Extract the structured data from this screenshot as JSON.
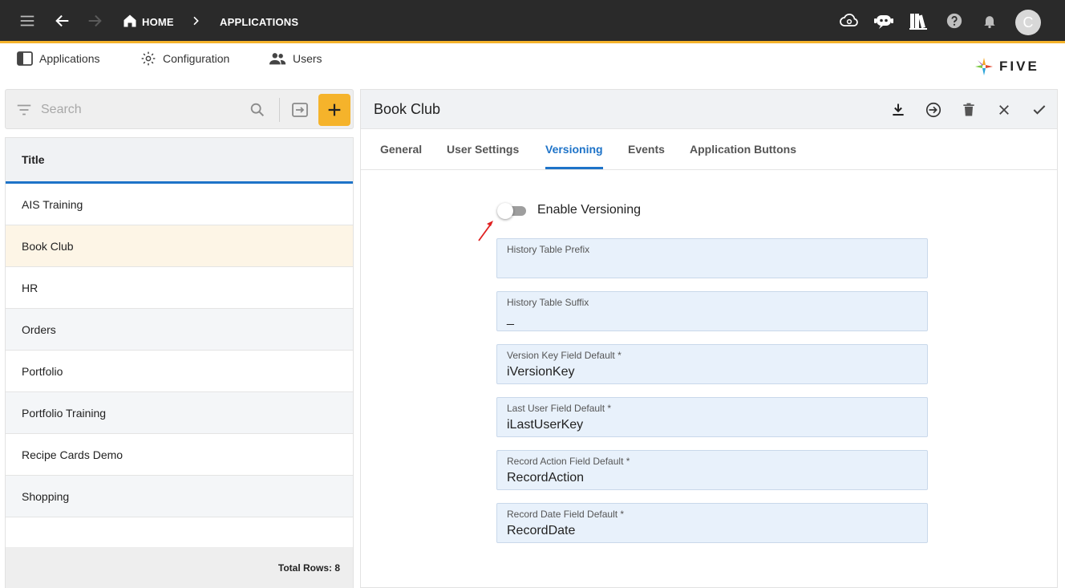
{
  "topbar": {
    "breadcrumb": [
      {
        "label": "HOME"
      },
      {
        "label": "APPLICATIONS"
      }
    ],
    "avatar_initial": "C"
  },
  "secnav": {
    "items": [
      {
        "label": "Applications",
        "icon": "applications-icon"
      },
      {
        "label": "Configuration",
        "icon": "configuration-icon"
      },
      {
        "label": "Users",
        "icon": "users-icon"
      }
    ],
    "logo_text": "FIVE"
  },
  "search": {
    "placeholder": "Search"
  },
  "list": {
    "header": "Title",
    "rows": [
      {
        "title": "AIS Training"
      },
      {
        "title": "Book Club"
      },
      {
        "title": "HR"
      },
      {
        "title": "Orders"
      },
      {
        "title": "Portfolio"
      },
      {
        "title": "Portfolio Training"
      },
      {
        "title": "Recipe Cards Demo"
      },
      {
        "title": "Shopping"
      }
    ],
    "selected_index": 1,
    "footer": "Total Rows: 8"
  },
  "detail": {
    "title": "Book Club",
    "tabs": [
      {
        "label": "General"
      },
      {
        "label": "User Settings"
      },
      {
        "label": "Versioning"
      },
      {
        "label": "Events"
      },
      {
        "label": "Application Buttons"
      }
    ],
    "active_tab": "Versioning",
    "toggle": {
      "label": "Enable Versioning",
      "checked": false
    },
    "fields": [
      {
        "label": "History Table Prefix",
        "value": ""
      },
      {
        "label": "History Table Suffix",
        "value": "_"
      },
      {
        "label": "Version Key Field Default *",
        "value": "iVersionKey"
      },
      {
        "label": "Last User Field Default *",
        "value": "iLastUserKey"
      },
      {
        "label": "Record Action Field Default *",
        "value": "RecordAction"
      },
      {
        "label": "Record Date Field Default *",
        "value": "RecordDate"
      }
    ]
  },
  "colors": {
    "topbar": "#2a2a2a",
    "accent": "#f5b32b",
    "primary": "#1e73c8",
    "field_bg": "#e8f1fb",
    "selected_row": "#fdf5e6",
    "annotation_arrow": "#e02020"
  }
}
